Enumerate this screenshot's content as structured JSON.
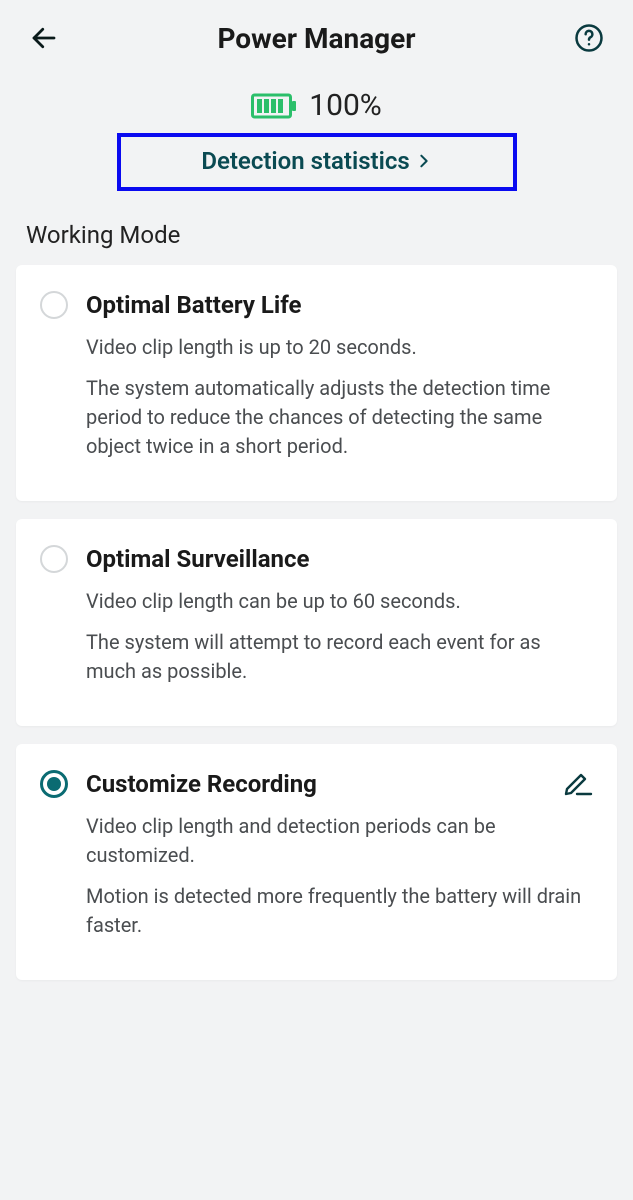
{
  "header": {
    "title": "Power Manager"
  },
  "battery": {
    "percent": "100%"
  },
  "detection_link": "Detection statistics",
  "section_label": "Working Mode",
  "modes": [
    {
      "title": "Optimal Battery Life",
      "line1": "Video clip length is up to 20 seconds.",
      "line2": "The system automatically adjusts the detection time period to reduce the chances of detecting the same object twice in a short period.",
      "selected": false,
      "editable": false
    },
    {
      "title": "Optimal Surveillance",
      "line1": "Video clip length can be up to 60 seconds.",
      "line2": "The system will attempt to record each event for as much as possible.",
      "selected": false,
      "editable": false
    },
    {
      "title": "Customize Recording",
      "line1": "Video clip length and detection periods can be customized.",
      "line2": "Motion is detected more frequently the battery will drain faster.",
      "selected": true,
      "editable": true
    }
  ]
}
